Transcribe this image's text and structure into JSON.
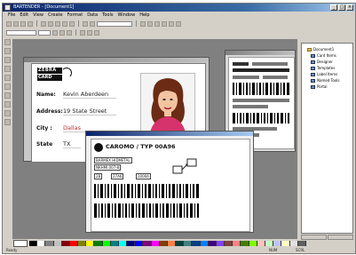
{
  "window": {
    "title": "BARTENDER - [Document1]"
  },
  "menu": [
    "File",
    "Edit",
    "View",
    "Create",
    "Format",
    "Data",
    "Tools",
    "Window",
    "Help"
  ],
  "card1": {
    "logo_line1": "ZEBRA",
    "logo_line2": "CARD",
    "fields": [
      {
        "label": "Name:",
        "value": "Kevin Aberdeen"
      },
      {
        "label": "Address:",
        "value": "19 State Street"
      },
      {
        "label": "City :",
        "value": "Dallas"
      },
      {
        "label": "State",
        "value": "TX"
      }
    ]
  },
  "card2": {
    "header": "CAROMO / TYP 00A96",
    "fields": [
      "BARMEX HIDMETAL",
      "NKHMI 007-8",
      "2B",
      "27A6",
      "1000A"
    ]
  },
  "tree": [
    "Document1",
    "Card Items",
    "Designer",
    "Templates",
    "Label Items",
    "Named Tools",
    "Portal"
  ],
  "status": [
    "Ready",
    "NUM",
    "SCRL"
  ],
  "palette_colors": [
    "#000000",
    "#ffffff",
    "#808080",
    "#c0c0c0",
    "#800000",
    "#ff0000",
    "#808000",
    "#ffff00",
    "#008000",
    "#00ff00",
    "#008080",
    "#00ffff",
    "#000080",
    "#0000ff",
    "#800080",
    "#ff00ff",
    "#804000",
    "#ff8040",
    "#004040",
    "#408080",
    "#004080",
    "#0080ff",
    "#400080",
    "#8040ff",
    "#804040",
    "#ff8080",
    "#408000",
    "#80ff00",
    "#ffc0c0",
    "#c0ffc0",
    "#c0c0ff",
    "#ffffc0",
    "#e0e0e0",
    "#606060"
  ]
}
